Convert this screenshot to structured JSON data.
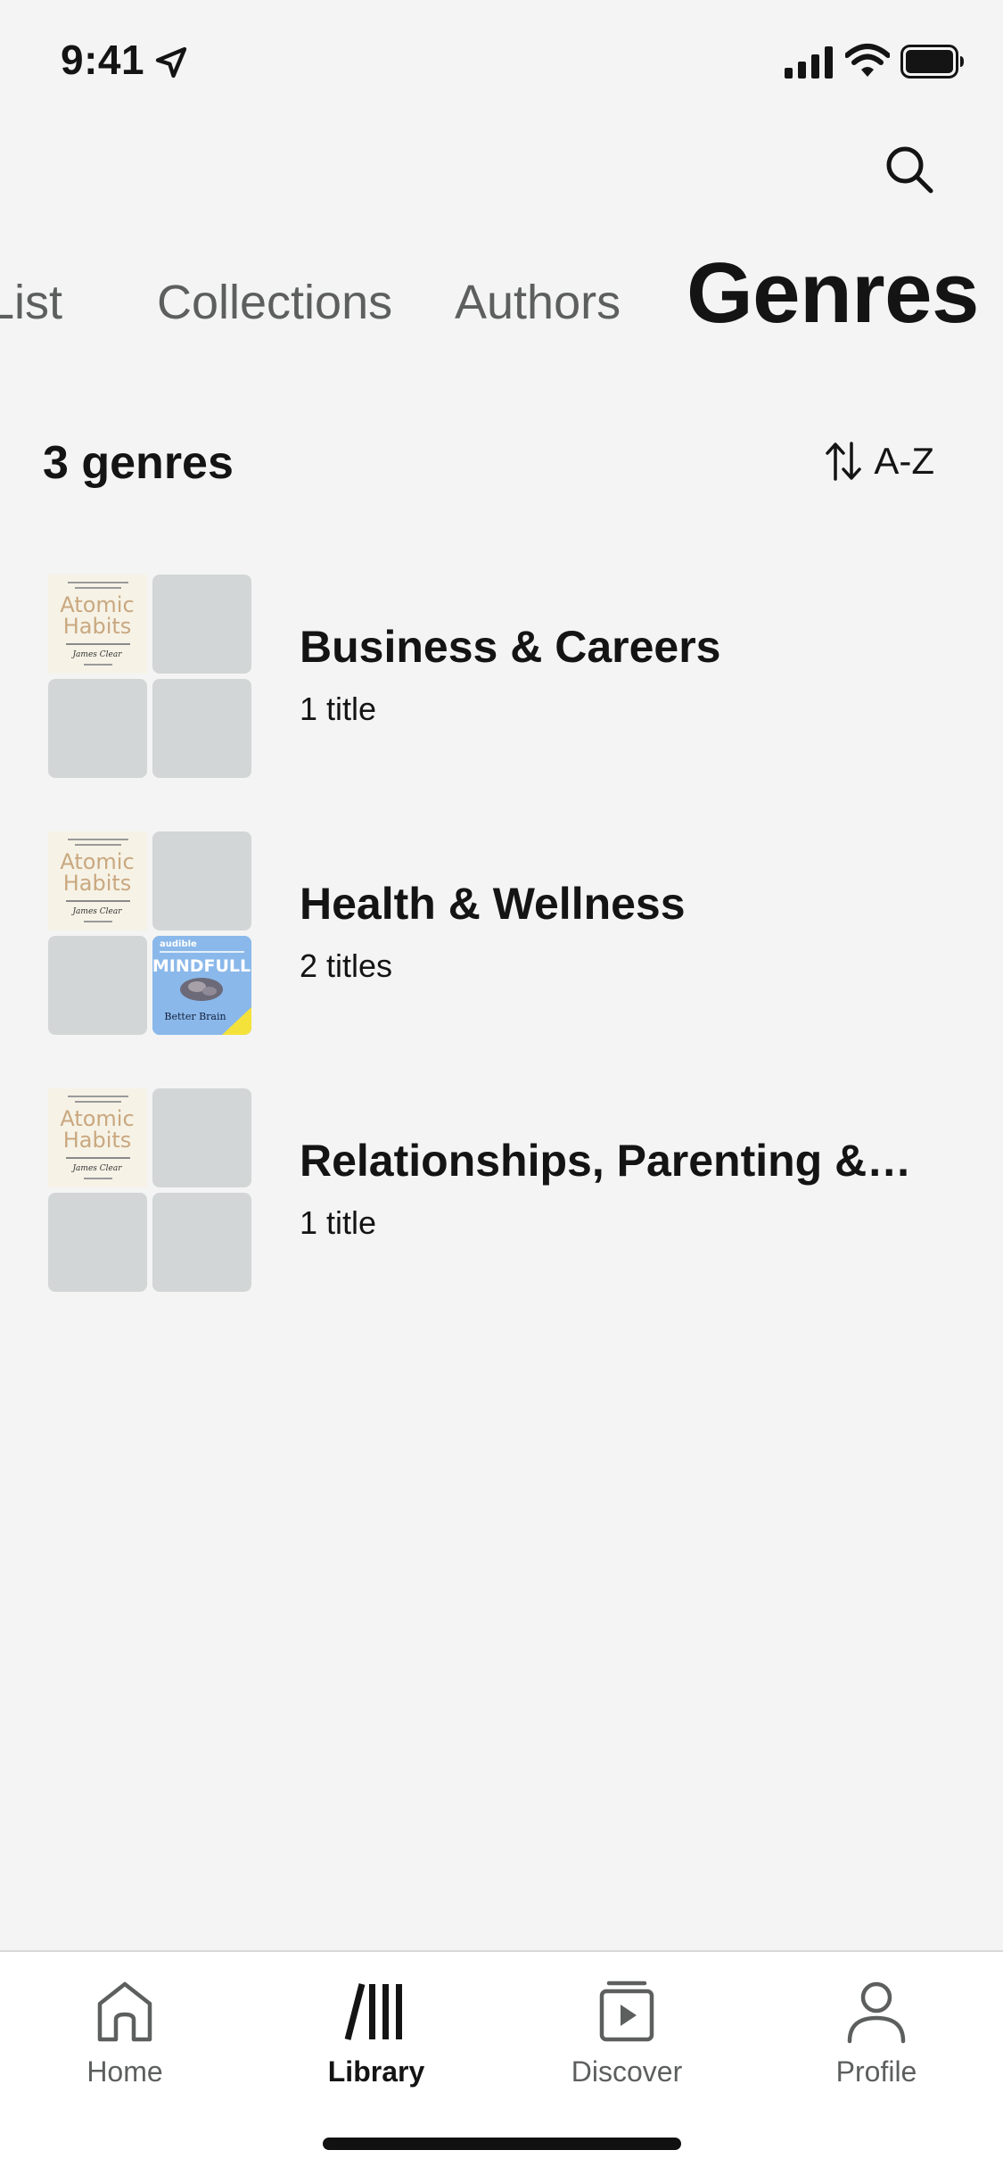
{
  "status_bar": {
    "time": "9:41"
  },
  "tabs": [
    {
      "label": "List",
      "state": "partially-visible"
    },
    {
      "label": "Collections",
      "state": "inactive"
    },
    {
      "label": "Authors",
      "state": "inactive"
    },
    {
      "label": "Genres",
      "state": "active"
    }
  ],
  "summary": {
    "count_label": "3 genres",
    "sort_label": "A-Z"
  },
  "genres": [
    {
      "name": "Business & Careers",
      "titles": "1 title",
      "covers": [
        "Atomic Habits",
        "",
        "",
        ""
      ]
    },
    {
      "name": "Health & Wellness",
      "titles": "2 titles",
      "covers": [
        "Atomic Habits",
        "",
        "",
        "MINDFULL"
      ]
    },
    {
      "name": "Relationships, Parenting &…",
      "titles": "1 title",
      "covers": [
        "Atomic Habits",
        "",
        "",
        ""
      ]
    }
  ],
  "covers": {
    "atomic": {
      "title_line1": "Atomic",
      "title_line2": "Habits",
      "author": "James Clear"
    },
    "mindfull": {
      "brand": "audible",
      "title": "MINDFULL",
      "subtitle": "Better Brain"
    }
  },
  "bottom_nav": [
    {
      "label": "Home",
      "icon": "home-icon"
    },
    {
      "label": "Library",
      "icon": "library-icon",
      "active": true
    },
    {
      "label": "Discover",
      "icon": "discover-icon"
    },
    {
      "label": "Profile",
      "icon": "profile-icon"
    }
  ],
  "colors": {
    "background": "#f3f4f3",
    "text": "#141414",
    "muted": "#5d5f5f",
    "placeholder": "#d3d6d6"
  }
}
